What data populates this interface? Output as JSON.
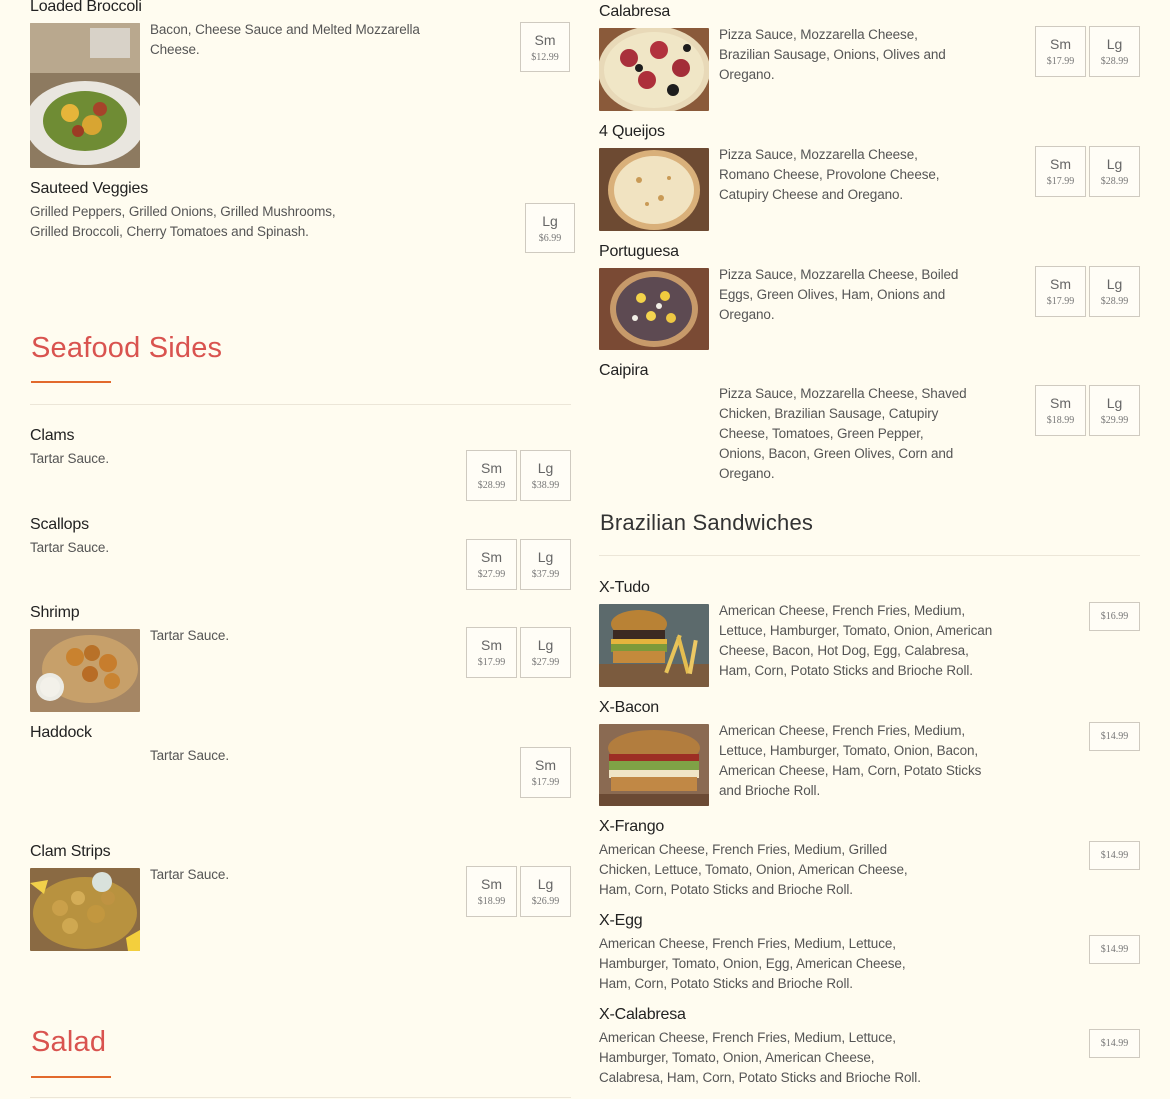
{
  "left_column": {
    "top_items": [
      {
        "name": "Loaded Broccoli",
        "desc": "Bacon, Cheese Sauce and Melted Mozzarella Cheese.",
        "prices": [
          {
            "size": "Sm",
            "amt": "$12.99"
          }
        ]
      },
      {
        "name": "Sauteed Veggies",
        "desc": "Grilled Peppers, Grilled Onions, Grilled Mushrooms, Grilled Broccoli, Cherry Tomatoes and Spinash.",
        "prices": [
          {
            "size": "Lg",
            "amt": "$6.99"
          }
        ]
      }
    ],
    "seafood_title": "Seafood Sides",
    "seafood_items": [
      {
        "name": "Clams",
        "desc": "Tartar Sauce.",
        "prices": [
          {
            "size": "Sm",
            "amt": "$28.99"
          },
          {
            "size": "Lg",
            "amt": "$38.99"
          }
        ]
      },
      {
        "name": "Scallops",
        "desc": "Tartar Sauce.",
        "prices": [
          {
            "size": "Sm",
            "amt": "$27.99"
          },
          {
            "size": "Lg",
            "amt": "$37.99"
          }
        ]
      },
      {
        "name": "Shrimp",
        "desc": "Tartar Sauce.",
        "prices": [
          {
            "size": "Sm",
            "amt": "$17.99"
          },
          {
            "size": "Lg",
            "amt": "$27.99"
          }
        ]
      },
      {
        "name": "Haddock",
        "desc": "Tartar Sauce.",
        "prices": [
          {
            "size": "Sm",
            "amt": "$17.99"
          }
        ]
      },
      {
        "name": "Clam Strips",
        "desc": "Tartar Sauce.",
        "prices": [
          {
            "size": "Sm",
            "amt": "$18.99"
          },
          {
            "size": "Lg",
            "amt": "$26.99"
          }
        ]
      }
    ],
    "salad_title": "Salad"
  },
  "right_column": {
    "pizzas": [
      {
        "name": "Calabresa",
        "desc": "Pizza Sauce, Mozzarella Cheese, Brazilian Sausage, Onions, Olives and Oregano.",
        "prices": [
          {
            "size": "Sm",
            "amt": "$17.99"
          },
          {
            "size": "Lg",
            "amt": "$28.99"
          }
        ]
      },
      {
        "name": "4 Queijos",
        "desc": "Pizza Sauce, Mozzarella Cheese, Romano Cheese, Provolone Cheese, Catupiry Cheese and Oregano.",
        "prices": [
          {
            "size": "Sm",
            "amt": "$17.99"
          },
          {
            "size": "Lg",
            "amt": "$28.99"
          }
        ]
      },
      {
        "name": "Portuguesa",
        "desc": "Pizza Sauce, Mozzarella Cheese, Boiled Eggs, Green Olives, Ham, Onions and Oregano.",
        "prices": [
          {
            "size": "Sm",
            "amt": "$17.99"
          },
          {
            "size": "Lg",
            "amt": "$28.99"
          }
        ]
      },
      {
        "name": "Caipira",
        "desc": "Pizza Sauce, Mozzarella Cheese, Shaved Chicken, Brazilian Sausage, Catupiry Cheese, Tomatoes, Green Pepper, Onions, Bacon, Green Olives, Corn and Oregano.",
        "prices": [
          {
            "size": "Sm",
            "amt": "$18.99"
          },
          {
            "size": "Lg",
            "amt": "$29.99"
          }
        ]
      }
    ],
    "sandwich_title": "Brazilian Sandwiches",
    "sandwiches": [
      {
        "name": "X-Tudo",
        "desc": "American Cheese, French Fries, Medium, Lettuce, Hamburger, Tomato, Onion, American Cheese, Bacon, Hot Dog, Egg, Calabresa, Ham, Corn, Potato Sticks and Brioche Roll.",
        "price": "$16.99"
      },
      {
        "name": "X-Bacon",
        "desc": "American Cheese, French Fries, Medium, Lettuce, Hamburger, Tomato, Onion, Bacon, American Cheese, Ham, Corn, Potato Sticks and Brioche Roll.",
        "price": "$14.99"
      },
      {
        "name": "X-Frango",
        "desc": "American Cheese, French Fries, Medium, Grilled Chicken, Lettuce, Tomato, Onion, American Cheese, Ham, Corn, Potato Sticks and Brioche Roll.",
        "price": "$14.99"
      },
      {
        "name": "X-Egg",
        "desc": "American Cheese, French Fries, Medium, Lettuce, Hamburger, Tomato, Onion, Egg, American Cheese, Ham, Corn, Potato Sticks and Brioche Roll.",
        "price": "$14.99"
      },
      {
        "name": "X-Calabresa",
        "desc": "American Cheese, French Fries, Medium, Lettuce, Hamburger, Tomato, Onion, American Cheese, Calabresa, Ham, Corn, Potato Sticks and Brioche Roll.",
        "price": "$14.99"
      }
    ]
  },
  "colors": {
    "background": "#fffcf0",
    "section_title": "#d9534f",
    "underline": "#e2692c"
  },
  "icons": [
    "food-photo"
  ]
}
